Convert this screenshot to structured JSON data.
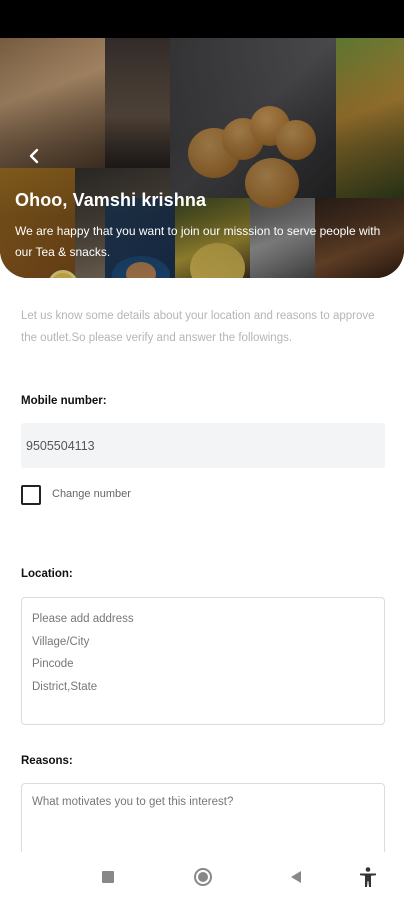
{
  "header": {
    "title": "Ohoo, Vamshi krishna",
    "subtitle": "We are happy that you want to join our misssion to serve people with our Tea & snacks."
  },
  "intro_text": "Let us know some details about your location and reasons to approve the outlet.So please verify and answer the followings.",
  "mobile": {
    "label": "Mobile number:",
    "value": "9505504113",
    "change_label": "Change number",
    "change_checked": false
  },
  "location": {
    "label": "Location:",
    "placeholder_lines": [
      "Please add address",
      "Village/City",
      "Pincode",
      "District,State"
    ]
  },
  "reasons": {
    "label": "Reasons:",
    "placeholder": "What motivates you to get this interest?"
  },
  "icons": {
    "back": "chevron-left-icon",
    "nav_recents": "square-icon",
    "nav_home": "circle-icon",
    "nav_back": "triangle-left-icon",
    "nav_accessibility": "accessibility-icon"
  },
  "colors": {
    "hero_text": "#ffffff",
    "field_bg": "#f2f4f6",
    "muted_text": "#b5b5b5"
  }
}
